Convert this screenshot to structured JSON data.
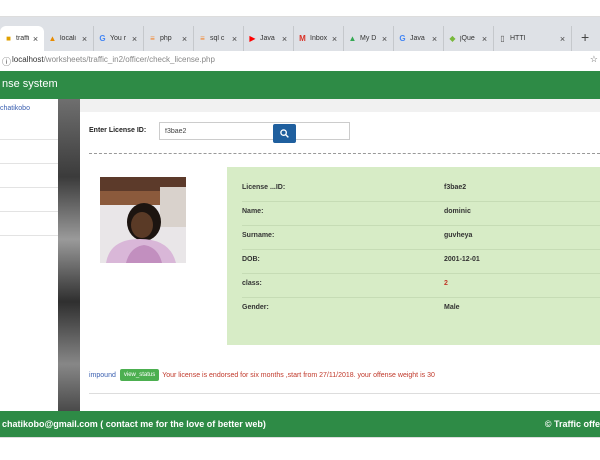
{
  "tabs": [
    {
      "label": "traffi",
      "icon": "folder-icon",
      "active": true
    },
    {
      "label": "locali",
      "icon": "phpmyadmin-icon"
    },
    {
      "label": "You r",
      "icon": "google-icon"
    },
    {
      "label": "php",
      "icon": "stackoverflow-icon"
    },
    {
      "label": "sql c",
      "icon": "stackoverflow-icon"
    },
    {
      "label": "Java",
      "icon": "youtube-icon"
    },
    {
      "label": "Inbox",
      "icon": "gmail-icon"
    },
    {
      "label": "My D",
      "icon": "drive-icon"
    },
    {
      "label": "Java",
      "icon": "google-icon"
    },
    {
      "label": "jQue",
      "icon": "jquery-icon"
    },
    {
      "label": "HTTI",
      "icon": "document-icon"
    }
  ],
  "address": {
    "host": "localhost",
    "path": "/worksheets/traffic_in2/officer/check_license.php"
  },
  "brand": {
    "title": "nse system"
  },
  "sidebar": {
    "user": "chatikobo"
  },
  "search": {
    "label": "Enter License ID:",
    "value": "f3bae2"
  },
  "license": {
    "rows": [
      {
        "label": "License ...ID:",
        "value": "f3bae2"
      },
      {
        "label": "Name:",
        "value": "dominic"
      },
      {
        "label": "Surname:",
        "value": "guvheya"
      },
      {
        "label": "DOB:",
        "value": "2001-12-01"
      },
      {
        "label": "class:",
        "value": "2"
      },
      {
        "label": "Gender:",
        "value": "Male"
      }
    ]
  },
  "notice": {
    "keyword": "impound",
    "badge": "view_status",
    "text": "Your license is endorsed for six months ,start from 27/11/2018. your offense weight is 30"
  },
  "footer": {
    "left": "chatikobo@gmail.com ( contact me for the love of better web)",
    "right": "© Traffic offe"
  },
  "colors": {
    "brand_green": "#2e8b46",
    "panel_green": "#d7ecc6",
    "search_blue": "#1f5f9e",
    "alert_red": "#c0392b"
  }
}
